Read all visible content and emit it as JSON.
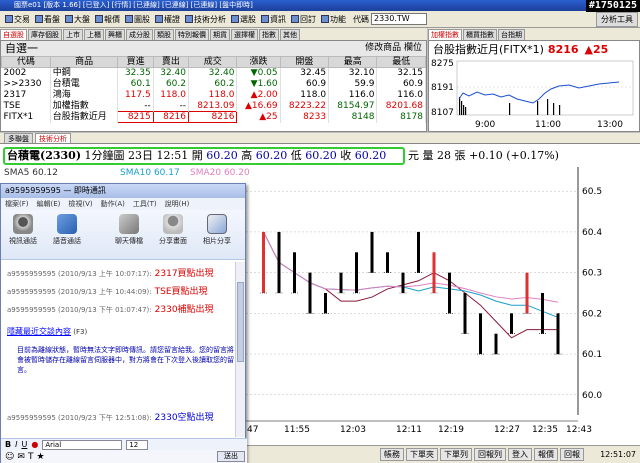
{
  "window": {
    "title": "國票e01 [版本 1.66] [已登入] [行情] [已連線] [已連線] [已連線] [盤中即時]",
    "badge": "#1750125",
    "controls": [
      "_",
      "□",
      "×"
    ]
  },
  "menu": {
    "items": [
      "交易",
      "看盤",
      "大盤",
      "報價",
      "圖股",
      "權證",
      "技術分析",
      "選股",
      "資訊",
      "回訂",
      "功能"
    ],
    "code_label": "代碼",
    "code_value": "2330.TW",
    "right_button": "分析工具"
  },
  "tabs_top": [
    "自選股",
    "庫存個股",
    "上市",
    "上櫃",
    "興櫃",
    "成分股",
    "類股",
    "特別報價",
    "期貨",
    "選擇權",
    "指數",
    "其他"
  ],
  "tabs_index": [
    "加權指數",
    "櫃買指數",
    "台指期"
  ],
  "quote": {
    "group_name": "自選一",
    "right_links": "修改商品 欄位",
    "headers": [
      "代碼",
      "商品",
      "買進",
      "賣出",
      "成交",
      "漲跌",
      "開盤",
      "最高",
      "最低"
    ],
    "rows": [
      {
        "code": "2002",
        "name": "中鋼",
        "bid": "32.35",
        "ask": "32.40",
        "last": "32.40",
        "chg": "▼0.05",
        "open": "32.45",
        "high": "32.10",
        "low": "32.15"
      },
      {
        "code": ">>2330",
        "name": "台積電",
        "bid": "60.1",
        "ask": "60.2",
        "last": "60.2",
        "chg": "▼1.60",
        "open": "60.9",
        "high": "59.9",
        "low": "60.9"
      },
      {
        "code": "2317",
        "name": "鴻海",
        "bid": "117.5",
        "ask": "118.0",
        "last": "118.0",
        "chg": "▲2.00",
        "open": "118.0",
        "high": "116.0",
        "low": "116.0"
      },
      {
        "code": "TSE",
        "name": "加權指數",
        "bid": "--",
        "ask": "--",
        "last": "8213.09",
        "chg": "▲16.69",
        "open": "8223.22",
        "high": "8154.97",
        "low": "8201.68"
      },
      {
        "code": "FITX*1",
        "name": "台股指數近月",
        "bid": "8215",
        "ask": "8216",
        "last": "8216",
        "chg": "▲25",
        "open": "8233",
        "high": "8148",
        "low": "8178"
      }
    ]
  },
  "index": {
    "name": "台股指數近月(FITX*1)",
    "value": "8216",
    "change": "▲25",
    "y_ticks": [
      "8275",
      "8191",
      "8107"
    ],
    "x_ticks": [
      "9:00",
      "11:00",
      "13:00"
    ]
  },
  "chart_tabs": [
    "多聯盤",
    "技術分析"
  ],
  "chart_header": {
    "name": "台積電(2330)",
    "period": "1分鐘圖",
    "day": "23日",
    "time": "12:51",
    "open_label": "開",
    "open": "60.20",
    "high_label": "高",
    "high": "60.20",
    "low_label": "低",
    "low": "60.20",
    "close_label": "收",
    "close": "60.20",
    "yuan": "元",
    "volume": "量 28 張",
    "change": "+0.10 (+0.17%)"
  },
  "ma_legend": [
    "SMA5 60.12",
    "SMA10 60.17",
    "SMA20 60.20"
  ],
  "chart_data": {
    "type": "bar",
    "title": "台積電(2330) 1分鐘圖",
    "y_ticks": [
      60.5,
      60.4,
      60.3,
      60.2,
      60.1,
      60.0
    ],
    "ylim": [
      59.97,
      60.53
    ],
    "x_ticks": [
      ":47",
      "11:55",
      "12:03",
      "12:11",
      "12:19",
      "12:27",
      "12:35",
      "12:43"
    ],
    "bars": [
      {
        "x": 0,
        "o": 60.25,
        "c": 60.4,
        "up": true
      },
      {
        "x": 1,
        "o": 60.4,
        "c": 60.25,
        "up": false
      },
      {
        "x": 2,
        "o": 60.35,
        "c": 60.25,
        "up": false
      },
      {
        "x": 3,
        "o": 60.3,
        "c": 60.2,
        "up": false
      },
      {
        "x": 4,
        "o": 60.25,
        "c": 60.2,
        "up": false
      },
      {
        "x": 5,
        "o": 60.3,
        "c": 60.25,
        "up": false
      },
      {
        "x": 6,
        "o": 60.35,
        "c": 60.25,
        "up": false
      },
      {
        "x": 7,
        "o": 60.4,
        "c": 60.3,
        "up": false
      },
      {
        "x": 8,
        "o": 60.35,
        "c": 60.3,
        "up": false
      },
      {
        "x": 9,
        "o": 60.3,
        "c": 60.25,
        "up": false
      },
      {
        "x": 10,
        "o": 60.4,
        "c": 60.3,
        "up": false
      },
      {
        "x": 11,
        "o": 60.25,
        "c": 60.35,
        "up": true
      },
      {
        "x": 12,
        "o": 60.3,
        "c": 60.2,
        "up": false
      },
      {
        "x": 13,
        "o": 60.25,
        "c": 60.15,
        "up": false
      },
      {
        "x": 14,
        "o": 60.2,
        "c": 60.1,
        "up": false
      },
      {
        "x": 15,
        "o": 60.15,
        "c": 60.1,
        "up": false
      },
      {
        "x": 16,
        "o": 60.2,
        "c": 60.15,
        "up": false
      },
      {
        "x": 17,
        "o": 60.2,
        "c": 60.3,
        "up": true
      },
      {
        "x": 18,
        "o": 60.25,
        "c": 60.15,
        "up": false
      },
      {
        "x": 19,
        "o": 60.2,
        "c": 60.1,
        "up": false
      }
    ],
    "series": [
      {
        "name": "SMA5",
        "color": "#8b1a3a"
      },
      {
        "name": "SMA10",
        "color": "#1aa0c8"
      },
      {
        "name": "SMA20",
        "color": "#e080c0"
      }
    ]
  },
  "chat": {
    "title": "a9595959595 — 即時通訊",
    "menu": [
      "檔案(F)",
      "編輯(E)",
      "檢視(V)",
      "動作(A)",
      "工具(T)",
      "說明(H)"
    ],
    "tools": [
      "視訊通話",
      "語音通話",
      "聊天傳檔",
      "分享畫面",
      "相片分享"
    ],
    "messages": [
      {
        "who": "a9595959595 (2010/9/13 上午 10:07:17):",
        "text": "2317買點出現",
        "top": 4
      },
      {
        "who": "a9595959595 (2010/9/13 上午 10:44:09):",
        "text": "TSE買點出現",
        "top": 22
      },
      {
        "who": "a9595959595 (2010/9/13 下午 01:07:47):",
        "text": "2330補點出現",
        "top": 40
      }
    ],
    "notice_link": "隱藏最近交談內容",
    "notice_key": "(F3)",
    "notice_text": "目前為離線狀態，暫時無法文字即時傳訊。請您留言給我。您的留言將會被暫時儲存在離線留言伺服器中，對方將會在下次登入後讀取您的留言。",
    "last_message": {
      "who": "a9595959595 (2010/9/23 下午 12:51:08):",
      "text": "2330空點出現"
    },
    "font": "Arial",
    "font_size": "12",
    "format_buttons": [
      "B",
      "I",
      "U"
    ],
    "send": "送出"
  },
  "status": {
    "buttons": [
      "帳務",
      "下單夾",
      "下單列",
      "回報列",
      "登入",
      "報價",
      "回報"
    ],
    "clock": "12:51:07"
  }
}
